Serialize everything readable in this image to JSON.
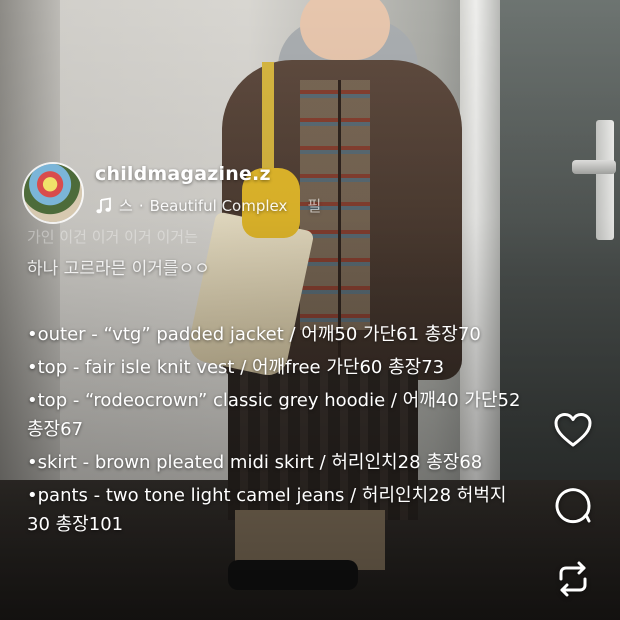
{
  "post": {
    "username": "childmagazine.z",
    "music": {
      "artist": "스",
      "separator": "·",
      "song": "Beautiful Complex",
      "overflow": "필"
    },
    "faded_line": "가인 이건 이거 이거 이거는",
    "caption_lead": "하나 고르라믄 이거를ㅇㅇ",
    "items": [
      "•outer - “vtg” padded jacket / 어깨50 가단61 총장70",
      "•top - fair isle knit vest / 어깨free 가단60 총장73",
      "•top - “rodeocrown” classic grey hoodie / 어깨40 가단52 총장67",
      "•skirt - brown pleated midi skirt / 허리인치28 총장68",
      "•pants - two tone light camel jeans / 허리인치28 허벅지30 총장101"
    ]
  },
  "actions": {
    "like_icon": "heart-icon",
    "comment_icon": "comment-icon",
    "repost_icon": "repost-icon"
  },
  "colors": {
    "text": "#ffffff",
    "avatar_ring": "#ffffff"
  }
}
